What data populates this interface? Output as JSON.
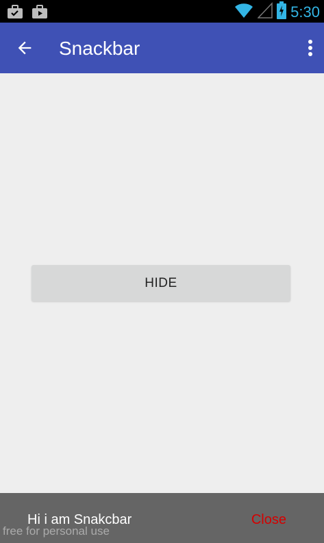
{
  "status_bar": {
    "time": "5:30",
    "icons": [
      "briefcase-check-icon",
      "briefcase-play-icon",
      "wifi-icon",
      "cell-signal-icon",
      "battery-charging-icon"
    ]
  },
  "app_bar": {
    "title": "Snackbar",
    "color": "#3f51b5",
    "back_icon": "arrow-back-icon",
    "menu_icon": "more-vert-icon"
  },
  "main": {
    "hide_button_label": "HIDE"
  },
  "snackbar": {
    "message": "Hi i am Snakcbar",
    "action_label": "Close",
    "action_color": "#d50000",
    "background": "#656565"
  },
  "watermark": "free for personal use"
}
